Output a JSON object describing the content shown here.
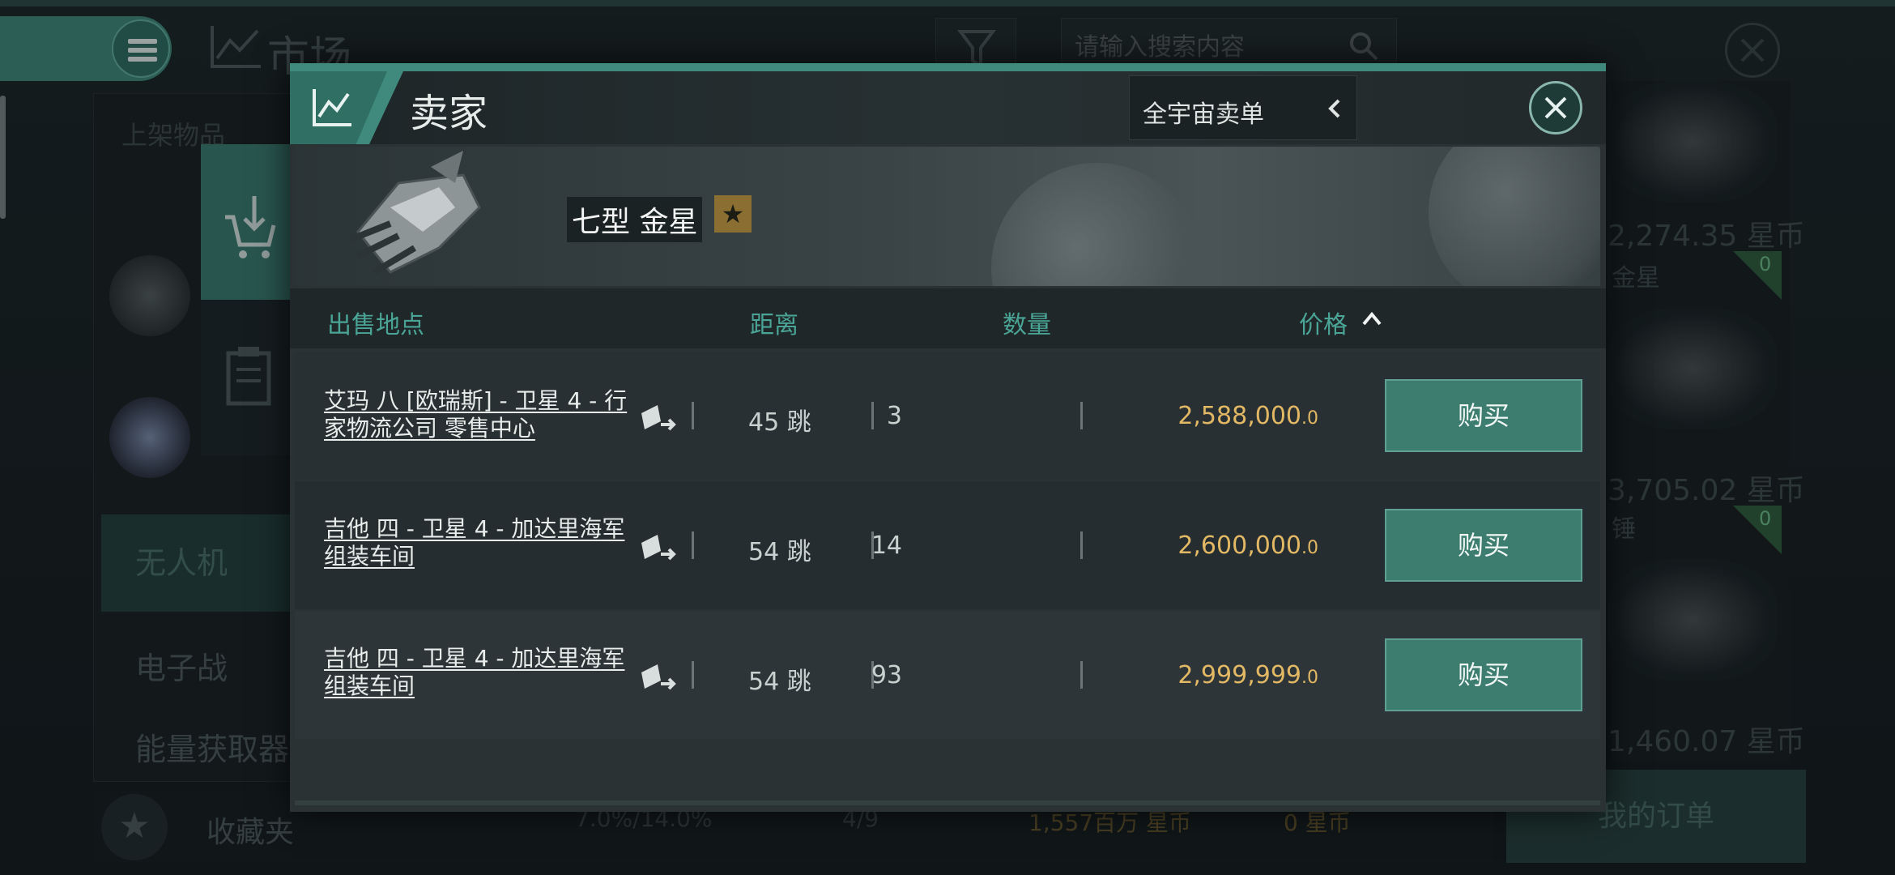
{
  "background": {
    "market_title": "市场",
    "search_placeholder": "请输入搜索内容",
    "left_panel": {
      "listed_label": "上架物品",
      "categories": [
        "无人机",
        "电子战",
        "能量获取器"
      ]
    },
    "right_column": {
      "prices": [
        "2,274.35 星币",
        "3,705.02 星币",
        "1,460.07 星币"
      ],
      "names": [
        "金星",
        "锤"
      ],
      "badges": [
        "0",
        "0"
      ]
    },
    "bottom_bar": {
      "favorites_label": "收藏夹",
      "tax_rate": "7.0%/14.0%",
      "order_count": "4/9",
      "balance": "1,557百万 星币",
      "escrow": "0 星币"
    },
    "my_orders_button": "我的订单"
  },
  "dialog": {
    "title": "卖家",
    "scope_select": "全宇宙卖单",
    "item": {
      "name": "七型 金星"
    },
    "columns": {
      "location": "出售地点",
      "distance": "距离",
      "quantity": "数量",
      "price": "价格"
    },
    "rows": [
      {
        "location": "艾玛 八 [欧瑞斯] - 卫星 4 - 行家物流公司 零售中心",
        "distance": "45 跳",
        "quantity": "3",
        "price_main": "2,588,000",
        "price_decimal": ".0",
        "buy_label": "购买"
      },
      {
        "location": "吉他 四 - 卫星 4 - 加达里海军 组装车间",
        "distance": "54 跳",
        "quantity": "14",
        "price_main": "2,600,000",
        "price_decimal": ".0",
        "buy_label": "购买"
      },
      {
        "location": "吉他 四 - 卫星 4 - 加达里海军 组装车间",
        "distance": "54 跳",
        "quantity": "93",
        "price_main": "2,999,999",
        "price_decimal": ".0",
        "buy_label": "购买"
      }
    ]
  },
  "colors": {
    "accent": "#3f8a7c",
    "price": "#e3b864",
    "header_text": "#4aa596"
  },
  "icons": [
    "menu-icon",
    "market-chart-icon",
    "filter-icon",
    "search-icon",
    "close-icon",
    "cart-download-icon",
    "clipboard-icon",
    "chart-icon",
    "chevron-left-icon",
    "star-icon",
    "route-icon",
    "chevron-up-icon"
  ]
}
